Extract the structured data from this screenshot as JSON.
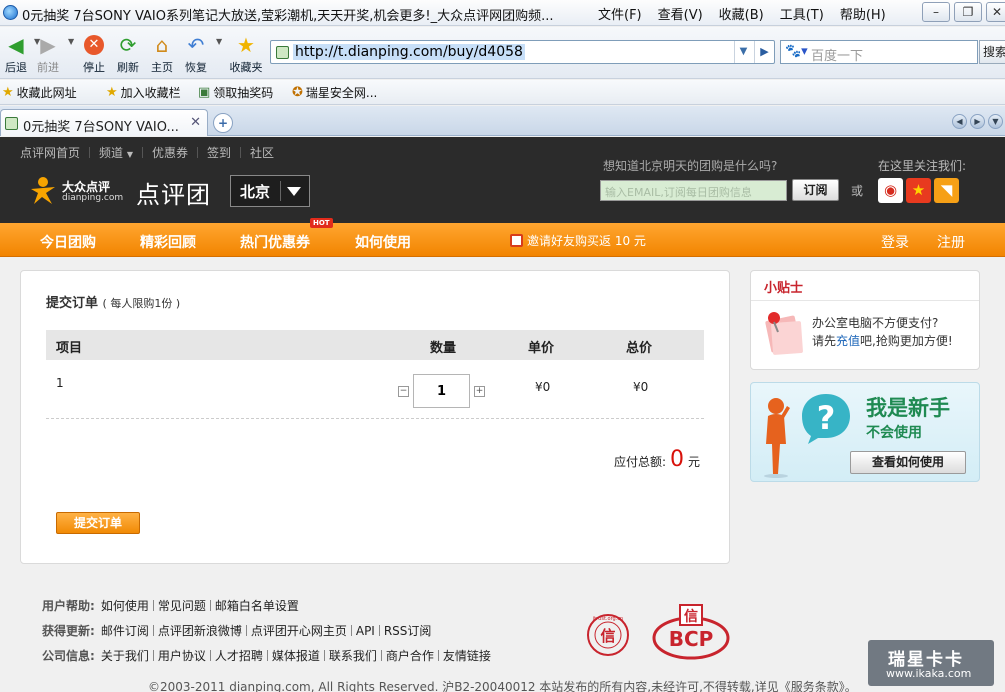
{
  "window": {
    "title": "0元抽奖 7台SONY VAIO系列笔记大放送,莹彩潮机,天天开奖,机会更多!_大众点评网团购频...",
    "menu": [
      "文件(F)",
      "查看(V)",
      "收藏(B)",
      "工具(T)",
      "帮助(H)"
    ]
  },
  "toolbar": {
    "back": "后退",
    "forward": "前进",
    "stop": "停止",
    "refresh": "刷新",
    "home": "主页",
    "restore": "恢复",
    "favorites": "收藏夹",
    "address": "http://t.dianping.com/buy/d4058",
    "search_placeholder": "百度一下",
    "search_button": "搜索"
  },
  "favbar": {
    "items": [
      "收藏此网址",
      "加入收藏栏",
      "领取抽奖码",
      "瑞星安全网..."
    ]
  },
  "tabs": {
    "active": "0元抽奖 7台SONY VAIO..."
  },
  "site": {
    "topnav": [
      "点评网首页",
      "频道",
      "优惠券",
      "签到",
      "社区"
    ],
    "logo_text": "大众点评",
    "logo_sub": "dianping.com",
    "brand": "点评团",
    "city": "北京",
    "subscribe_question": "想知道北京明天的团购是什么吗?",
    "email_placeholder": "输入EMAIL,订阅每日团购信息",
    "subscribe_button": "订阅",
    "or": "或",
    "follow": "在这里关注我们:"
  },
  "nav": {
    "items": [
      "今日团购",
      "精彩回顾",
      "热门优惠券",
      "如何使用"
    ],
    "hot": "HOT",
    "invite": "邀请好友购买返 10 元",
    "login": "登录",
    "register": "注册"
  },
  "order": {
    "title": "提交订单",
    "limit": "( 每人限购1份 )",
    "headers": {
      "item": "项目",
      "qty": "数量",
      "unit": "单价",
      "total": "总价"
    },
    "row": {
      "name": "1",
      "qty": "1",
      "unit": "¥0",
      "total": "¥0"
    },
    "pay_label": "应付总额:",
    "pay_amount": "0",
    "pay_unit": "元",
    "submit": "提交订单"
  },
  "tips": {
    "title": "小贴士",
    "line1": "办公室电脑不方便支付?",
    "line2_a": "请先",
    "line2_link": "充值",
    "line2_b": "吧,抢购更加方便!"
  },
  "newbie": {
    "t1": "我是新手",
    "t2": "不会使用",
    "button": "查看如何使用"
  },
  "footer": {
    "help_label": "用户帮助:",
    "help": [
      "如何使用",
      "常见问题",
      "邮箱白名单设置"
    ],
    "updates_label": "获得更新:",
    "updates": [
      "邮件订阅",
      "点评团新浪微博",
      "点评团开心网主页",
      "API",
      "RSS订阅"
    ],
    "company_label": "公司信息:",
    "company": [
      "关于我们",
      "用户协议",
      "人才招聘",
      "媒体报道",
      "联系我们",
      "商户合作",
      "友情链接"
    ],
    "copyright": "©2003-2011 dianping.com, All Rights Reserved. 沪B2-20040012 本站发布的所有内容,未经许可,不得转载,详见《服务条款》。",
    "seal1": "信",
    "seal1_ring": "itrust.org.cn",
    "seal2": "BCP",
    "seal2_top": "信"
  },
  "watermark": {
    "title": "瑞星卡卡",
    "url": "www.ikaka.com"
  }
}
